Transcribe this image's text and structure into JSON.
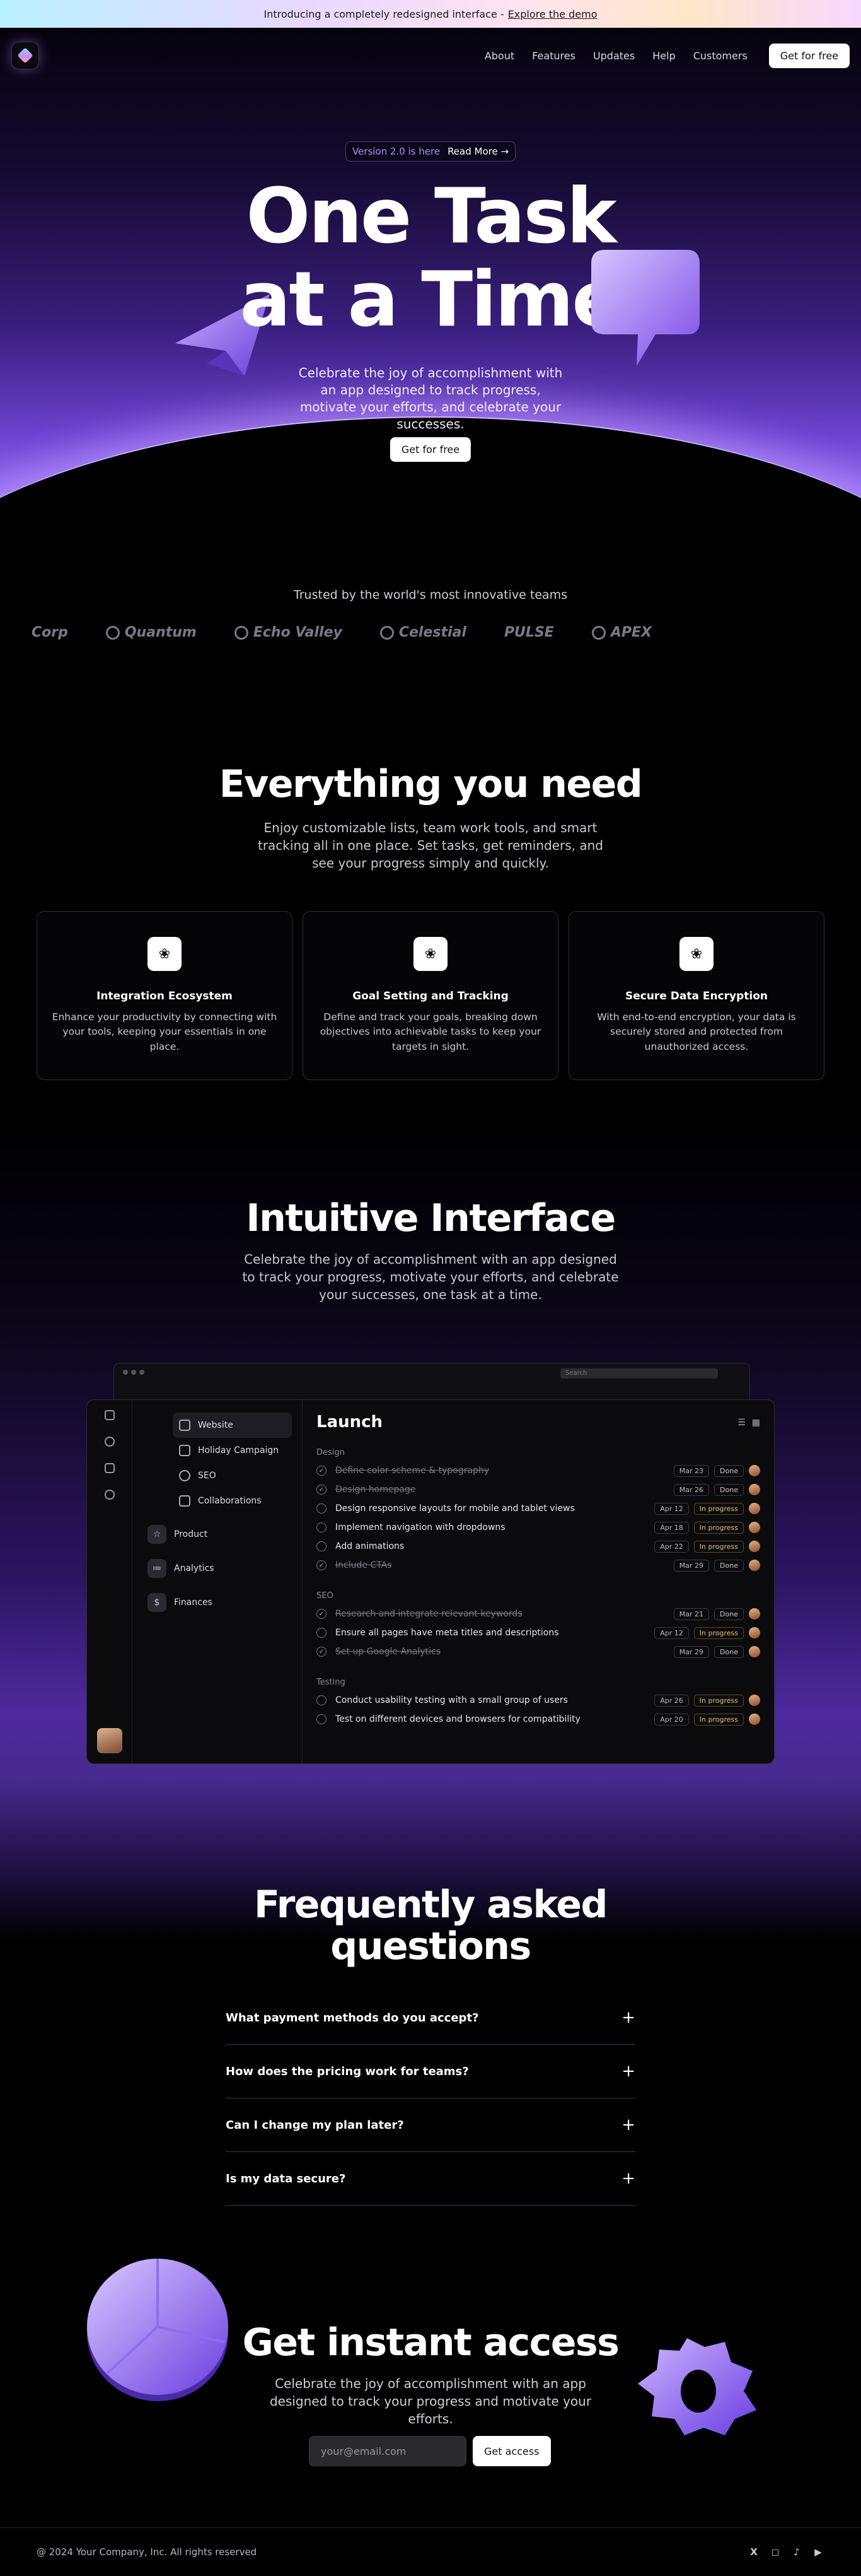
{
  "announcement": {
    "text": "Introducing a completely redesigned interface -",
    "link": "Explore the demo"
  },
  "nav": {
    "links": [
      "About",
      "Features",
      "Updates",
      "Help",
      "Customers"
    ],
    "cta": "Get for free"
  },
  "hero": {
    "version": "Version 2.0 is here",
    "read_more": "Read More →",
    "title_line1": "One Task",
    "title_line2": "at a Time",
    "subtitle": "Celebrate the joy of accomplishment with an app designed to track progress, motivate your efforts, and celebrate your successes.",
    "cta": "Get for free"
  },
  "trusted": {
    "title": "Trusted by the world's most innovative teams",
    "logos": [
      "Corp",
      "Quantum",
      "Echo Valley",
      "Celestial",
      "PULSE",
      "APEX"
    ]
  },
  "features": {
    "title": "Everything you need",
    "subtitle": "Enjoy customizable lists, team work tools, and smart tracking all in one place. Set tasks, get reminders, and see your progress simply and quickly.",
    "cards": [
      {
        "title": "Integration Ecosystem",
        "desc": "Enhance your productivity by connecting with your tools, keeping your essentials in one place."
      },
      {
        "title": "Goal Setting and Tracking",
        "desc": "Define and track your goals, breaking down objectives into achievable tasks to keep your targets in sight."
      },
      {
        "title": "Secure Data Encryption",
        "desc": "With end-to-end encryption, your data is securely stored and protected from unauthorized access."
      }
    ]
  },
  "interface": {
    "title": "Intuitive Interface",
    "subtitle": "Celebrate the joy of accomplishment with an app designed to track your progress, motivate your efforts, and celebrate your successes, one task at a time.",
    "search_placeholder": "Search",
    "sidebar_items": [
      "Website",
      "Holiday Campaign",
      "SEO",
      "Collaborations"
    ],
    "sidebar_groups": [
      "Product",
      "Analytics",
      "Finances"
    ],
    "main_title": "Launch",
    "groups": [
      {
        "label": "Design",
        "tasks": [
          {
            "text": "Define color scheme & typography",
            "date": "Mar 23",
            "status": "Done",
            "done": true
          },
          {
            "text": "Design homepage",
            "date": "Mar 26",
            "status": "Done",
            "done": true
          },
          {
            "text": "Design responsive layouts for mobile and tablet views",
            "date": "Apr 12",
            "status": "In progress",
            "done": false
          },
          {
            "text": "Implement navigation with dropdowns",
            "date": "Apr 18",
            "status": "In progress",
            "done": false
          },
          {
            "text": "Add animations",
            "date": "Apr 22",
            "status": "In progress",
            "done": false
          },
          {
            "text": "Include CTAs",
            "date": "Mar 29",
            "status": "Done",
            "done": true
          }
        ]
      },
      {
        "label": "SEO",
        "tasks": [
          {
            "text": "Research and integrate relevant keywords",
            "date": "Mar 21",
            "status": "Done",
            "done": true
          },
          {
            "text": "Ensure all pages have meta titles and descriptions",
            "date": "Apr 12",
            "status": "In progress",
            "done": false
          },
          {
            "text": "Set up Google Analytics",
            "date": "Mar 29",
            "status": "Done",
            "done": true
          }
        ]
      },
      {
        "label": "Testing",
        "tasks": [
          {
            "text": "Conduct usability testing with a small group of users",
            "date": "Apr 26",
            "status": "In progress",
            "done": false
          },
          {
            "text": "Test on different devices and browsers for compatibility",
            "date": "Apr 20",
            "status": "In progress",
            "done": false
          }
        ]
      }
    ]
  },
  "faq": {
    "title_line1": "Frequently asked",
    "title_line2": "questions",
    "items": [
      "What payment methods do you accept?",
      "How does the pricing work for teams?",
      "Can I change my plan later?",
      "Is my data secure?"
    ]
  },
  "access": {
    "title": "Get instant access",
    "subtitle": "Celebrate the joy of accomplishment with an app designed to track your progress and motivate your efforts.",
    "email_placeholder": "your@email.com",
    "cta": "Get access"
  },
  "footer": {
    "copyright": "@ 2024 Your Company, Inc. All rights reserved",
    "socials": [
      "x-icon",
      "instagram-icon",
      "tiktok-icon",
      "youtube-icon"
    ]
  },
  "colors": {
    "accent": "#8b5cf6",
    "background": "#000000"
  }
}
